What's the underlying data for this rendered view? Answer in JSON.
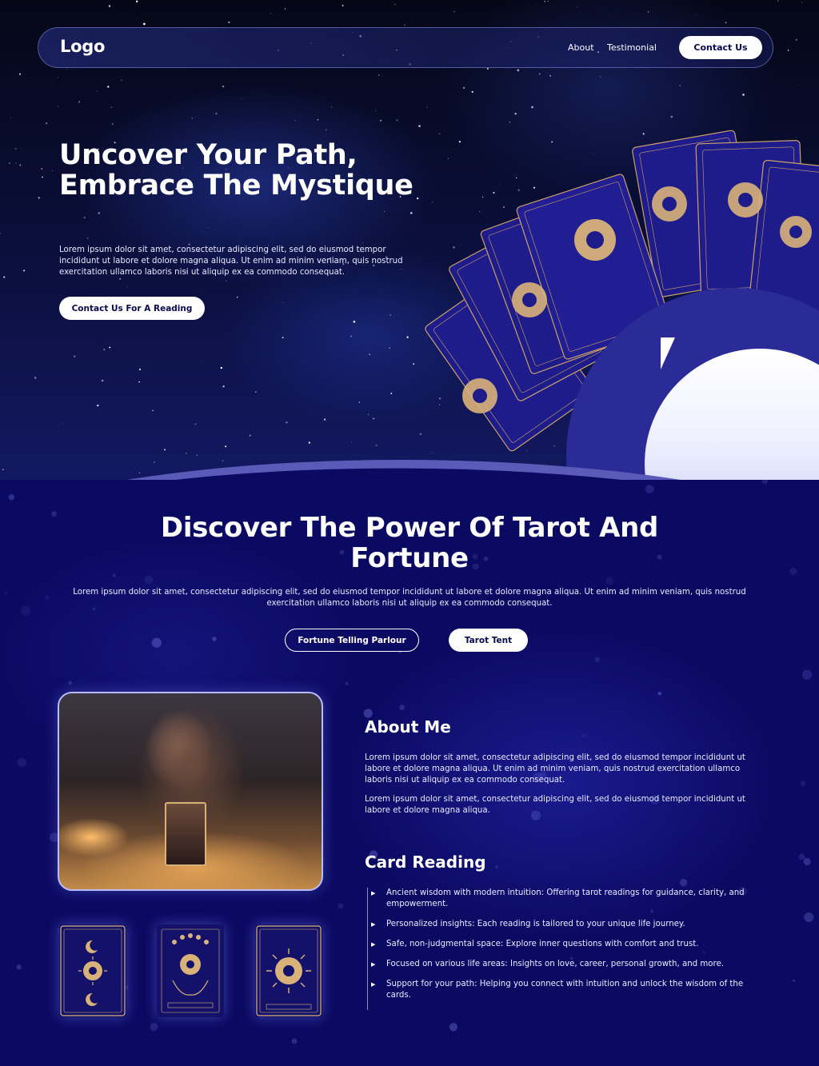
{
  "nav": {
    "logo": "Logo",
    "links": [
      "About",
      "Testimonial"
    ],
    "contact": "Contact Us"
  },
  "hero": {
    "title": "Uncover Your Path, Embrace The Mystique",
    "text": "Lorem ipsum dolor sit amet, consectetur adipiscing elit, sed do eiusmod tempor incididunt ut labore et dolore magna aliqua. Ut enim ad minim veniam, quis nostrud exercitation ullamco laboris nisi ut aliquip ex ea commodo consequat.",
    "button": "Contact Us For A Reading"
  },
  "discover": {
    "title": "Discover The Power Of Tarot And Fortune",
    "text": "Lorem ipsum dolor sit amet, consectetur adipiscing elit, sed do eiusmod tempor incididunt ut labore et dolore magna aliqua. Ut enim ad minim veniam, quis nostrud exercitation ullamco laboris nisi ut aliquip ex ea commodo consequat.",
    "buttons": [
      "Fortune Telling Parlour",
      "Tarot Tent"
    ]
  },
  "about": {
    "title": "About Me",
    "p1": "Lorem ipsum dolor sit amet, consectetur adipiscing elit, sed do eiusmod tempor incididunt ut labore et dolore magna aliqua. Ut enim ad minim veniam, quis nostrud exercitation ullamco laboris nisi ut aliquip ex ea commodo consequat.",
    "p2": " Lorem ipsum dolor sit amet, consectetur adipiscing elit, sed do eiusmod tempor incididunt ut labore et dolore magna aliqua."
  },
  "reading": {
    "title": "Card Reading",
    "items": [
      "Ancient wisdom with modern intuition: Offering tarot readings for guidance, clarity, and empowerment.",
      "Personalized insights: Each reading is tailored to your unique life journey.",
      "Safe, non-judgmental space: Explore inner questions with comfort and trust.",
      "Focused on various life areas: Insights on love, career, personal growth, and more.",
      "Support for your path: Helping you connect with intuition and unlock the wisdom of the cards."
    ]
  },
  "colors": {
    "background": "#0b0a62",
    "accent": "#2a2b96",
    "gold": "#d9b27a",
    "button": "#ffffff",
    "button_text": "#0a0a50"
  }
}
